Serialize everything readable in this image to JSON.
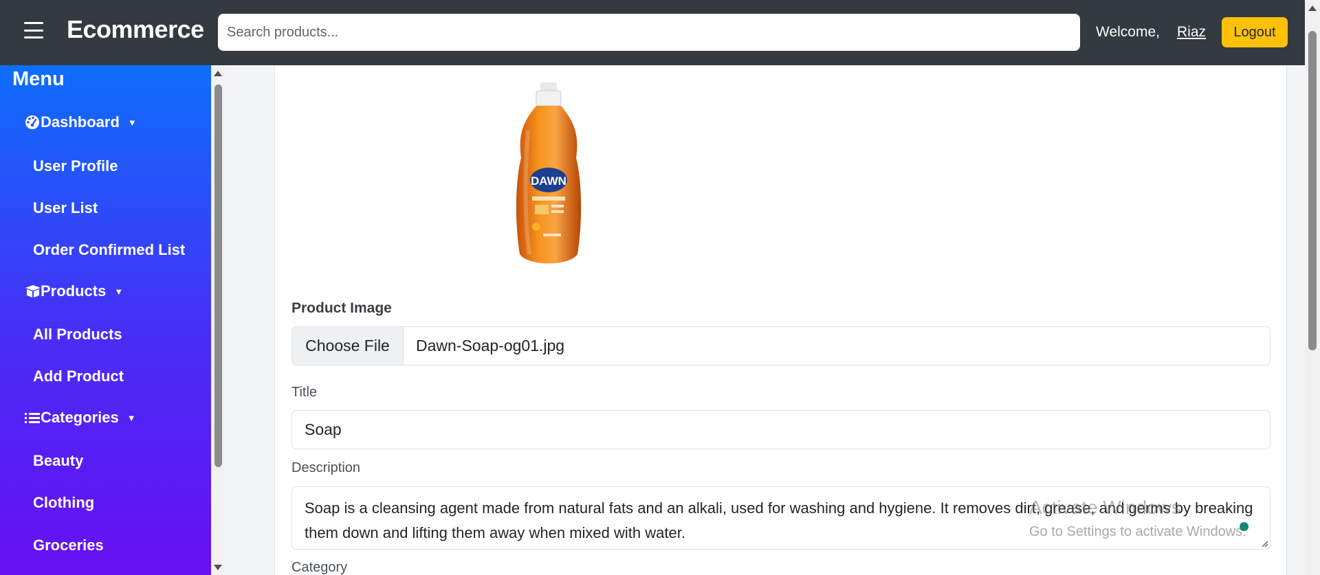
{
  "navbar": {
    "brand": "Ecommerce",
    "search_placeholder": "Search products...",
    "welcome": "Welcome,",
    "username": "Riaz",
    "logout": "Logout",
    "logout_color": "#ffc107"
  },
  "sidebar": {
    "title": "Menu",
    "sections": [
      {
        "label": "Dashboard",
        "icon": "dashboard-gauge-icon",
        "items": [
          "User Profile",
          "User List",
          "Order Confirmed List"
        ]
      },
      {
        "label": "Products",
        "icon": "box-icon",
        "items": [
          "All Products",
          "Add Product"
        ]
      },
      {
        "label": "Categories",
        "icon": "list-icon",
        "items": [
          "Beauty",
          "Clothing",
          "Groceries"
        ]
      }
    ],
    "gradient_top": "#0d6efd",
    "gradient_bottom": "#6610f2"
  },
  "form": {
    "image_label": "Product Image",
    "choose_file": "Choose File",
    "file_name": "Dawn-Soap-og01.jpg",
    "title_label": "Title",
    "title_value": "Soap",
    "description_label": "Description",
    "description_value": "Soap is a cleansing agent made from natural fats and an alkali, used for washing and hygiene. It removes dirt, grease, and germs by breaking them down and lifting them away when mixed with water.",
    "category_label": "Category",
    "product_image_text": "DAWN"
  },
  "watermark": {
    "line1": "Activate Windows",
    "line2": "Go to Settings to activate Windows."
  }
}
